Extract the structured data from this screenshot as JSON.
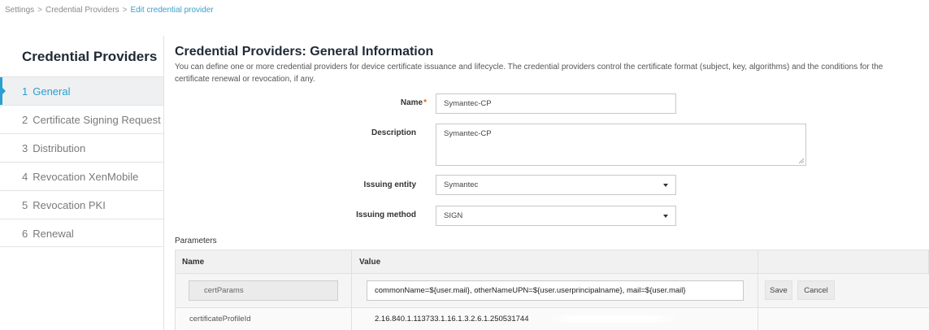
{
  "breadcrumb": {
    "items": [
      "Settings",
      "Credential Providers"
    ],
    "current": "Edit credential provider"
  },
  "sidebar": {
    "title": "Credential Providers",
    "items": [
      {
        "num": "1",
        "label": "General",
        "active": true
      },
      {
        "num": "2",
        "label": "Certificate Signing Request",
        "active": false
      },
      {
        "num": "3",
        "label": "Distribution",
        "active": false
      },
      {
        "num": "4",
        "label": "Revocation XenMobile",
        "active": false
      },
      {
        "num": "5",
        "label": "Revocation PKI",
        "active": false
      },
      {
        "num": "6",
        "label": "Renewal",
        "active": false
      }
    ]
  },
  "main": {
    "title": "Credential Providers: General Information",
    "description": "You can define one or more credential providers for device certificate issuance and lifecycle. The credential providers control the certificate format (subject, key, algorithms) and the conditions for the certificate renewal or revocation, if any."
  },
  "form": {
    "name": {
      "label": "Name",
      "required_mark": "*",
      "value": "Symantec-CP"
    },
    "description": {
      "label": "Description",
      "value": "Symantec-CP"
    },
    "issuing_entity": {
      "label": "Issuing entity",
      "value": "Symantec"
    },
    "issuing_method": {
      "label": "Issuing method",
      "value": "SIGN"
    }
  },
  "parameters": {
    "label": "Parameters",
    "columns": [
      "Name",
      "Value"
    ],
    "rows": [
      {
        "name": "certParams",
        "value": "commonName=${user.mail}, otherNameUPN=${user.userprincipalname}, mail=${user.mail}",
        "save_label": "Save",
        "cancel_label": "Cancel"
      },
      {
        "name": "certificateProfileId",
        "value": "2.16.840.1.113733.1.16.1.3.2.6.1.250531744"
      }
    ]
  },
  "colors": {
    "accent": "#2a9fd1",
    "required": "#e05a2a",
    "sidebar_active_bg": "#eef0f2"
  }
}
